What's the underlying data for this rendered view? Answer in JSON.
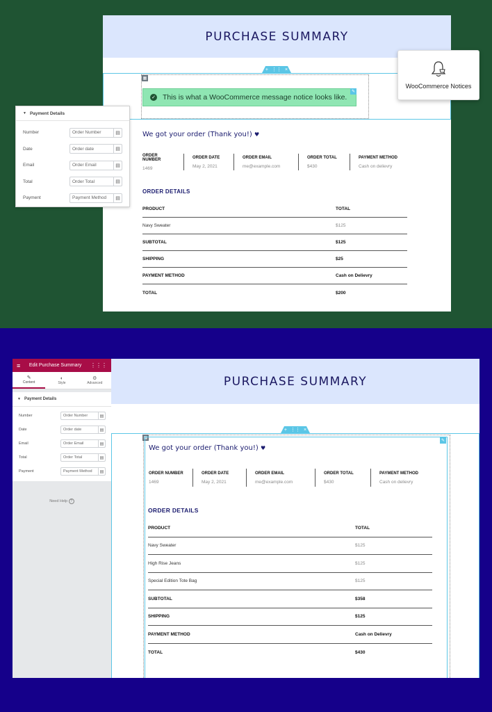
{
  "top": {
    "banner_title": "PURCHASE SUMMARY",
    "notice_text": "This is what a WooCommerce message notice looks like.",
    "notices_widget_label": "WooCommerce Notices",
    "thanks": "We got your order (Thank you!)",
    "meta": [
      {
        "label": "ORDER NUMBER",
        "value": "1469"
      },
      {
        "label": "ORDER DATE",
        "value": "May 2, 2021"
      },
      {
        "label": "ORDER EMAIL",
        "value": "me@example.com"
      },
      {
        "label": "ORDER TOTAL",
        "value": "$430"
      },
      {
        "label": "PAYMENT METHOD",
        "value": "Cash on delievry"
      }
    ],
    "order_details_title": "ORDER DETAILS",
    "table": {
      "headers": [
        "PRODUCT",
        "TOTAL"
      ],
      "items": [
        {
          "name": "Navy Sweater",
          "total": "$125"
        }
      ],
      "totals": [
        {
          "label": "SUBTOTAL",
          "value": "$125"
        },
        {
          "label": "SHIPPING",
          "value": "$25"
        },
        {
          "label": "PAYMENT METHOD",
          "value": "Cash on Delievry"
        },
        {
          "label": "TOTAL",
          "value": "$200"
        }
      ]
    },
    "panel": {
      "section_title": "Payment Details",
      "fields": [
        {
          "label": "Number",
          "value": "Order Number"
        },
        {
          "label": "Date",
          "value": "Order date"
        },
        {
          "label": "Email",
          "value": "Order Email"
        },
        {
          "label": "Total",
          "value": "Order Total"
        },
        {
          "label": "Payment",
          "value": "Payment Method"
        }
      ]
    }
  },
  "bottom": {
    "editor": {
      "header_title": "Edit Purchase Summary",
      "tabs": [
        {
          "label": "Content",
          "icon": "pencil-icon"
        },
        {
          "label": "Style",
          "icon": "half-circle-icon"
        },
        {
          "label": "Advanced",
          "icon": "gear-icon"
        }
      ],
      "section_title": "Payment Details",
      "fields": [
        {
          "label": "Number",
          "value": "Order Number"
        },
        {
          "label": "Date",
          "value": "Order date"
        },
        {
          "label": "Email",
          "value": "Order Email"
        },
        {
          "label": "Total",
          "value": "Order Total"
        },
        {
          "label": "Payment",
          "value": "Payment Method"
        }
      ],
      "need_help": "Need Help"
    },
    "banner_title": "PURCHASE SUMMARY",
    "thanks": "We got your order (Thank you!)",
    "meta": [
      {
        "label": "ORDER NUMBER",
        "value": "1469"
      },
      {
        "label": "ORDER DATE",
        "value": "May 2, 2021"
      },
      {
        "label": "ORDER EMAIL",
        "value": "me@example.com"
      },
      {
        "label": "ORDER TOTAL",
        "value": "$430"
      },
      {
        "label": "PAYMENT METHOD",
        "value": "Cash on delievry"
      }
    ],
    "order_details_title": "ORDER DETAILS",
    "table": {
      "headers": [
        "PRODUCT",
        "TOTAL"
      ],
      "items": [
        {
          "name": "Navy Sweater",
          "total": "$125"
        },
        {
          "name": "High Rise Jeans",
          "total": "$125"
        },
        {
          "name": "Special Edition Tote Bag",
          "total": "$125"
        }
      ],
      "totals": [
        {
          "label": "SUBTOTAL",
          "value": "$358"
        },
        {
          "label": "SHIPPING",
          "value": "$125"
        },
        {
          "label": "PAYMENT METHOD",
          "value": "Cash on Delievry"
        },
        {
          "label": "TOTAL",
          "value": "$430"
        }
      ]
    }
  },
  "colors": {
    "top_background": "#1f5433",
    "bottom_background": "#15008a",
    "banner": "#dbe6fd",
    "heading_text": "#1a1760",
    "editor_header": "#a80d47",
    "selection_outline": "#5bc6e6",
    "notice_green": "#8fe6b3"
  }
}
